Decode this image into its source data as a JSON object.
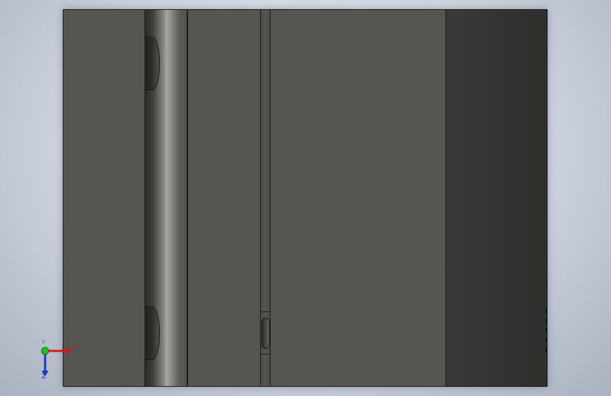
{
  "viewport": {
    "background": "#cdd3de",
    "model_face_color": "#54564f",
    "dark_face_color": "#333331",
    "edge_color": "#1e1e1e"
  },
  "triad": {
    "x_label": "X",
    "y_label": "Y",
    "z_label": "Z",
    "x_color": "#d01818",
    "y_color": "#20a020",
    "z_color": "#2030c0"
  }
}
